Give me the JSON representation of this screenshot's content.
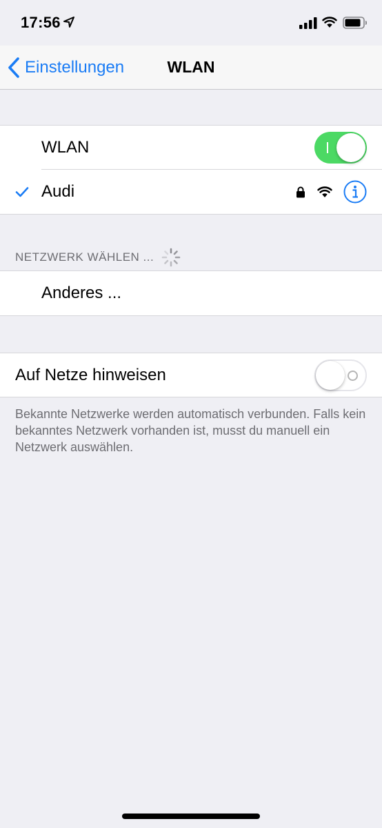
{
  "status_bar": {
    "time": "17:56",
    "icons": [
      "location-arrow-icon",
      "cellular-signal-icon",
      "wifi-icon",
      "battery-icon"
    ]
  },
  "nav": {
    "back_label": "Einstellungen",
    "title": "WLAN"
  },
  "wifi_group": {
    "wifi_label": "WLAN",
    "wifi_enabled": true,
    "connected_network": "Audi",
    "connected_icons": [
      "checkmark-icon",
      "lock-icon",
      "wifi-signal-icon",
      "info-icon"
    ]
  },
  "network_section": {
    "header": "NETZWERK WÄHLEN ...",
    "other_label": "Anderes ..."
  },
  "ask_group": {
    "label": "Auf Netze hinweisen",
    "enabled": false,
    "footer": "Bekannte Netzwerke werden automatisch verbunden. Falls kein bekanntes Netzwerk vorhanden ist, musst du manuell ein Netzwerk auswählen."
  },
  "colors": {
    "accent": "#1a7cf5",
    "toggle_on": "#4cd964",
    "background": "#efeff4",
    "secondary_text": "#6d6d72"
  }
}
